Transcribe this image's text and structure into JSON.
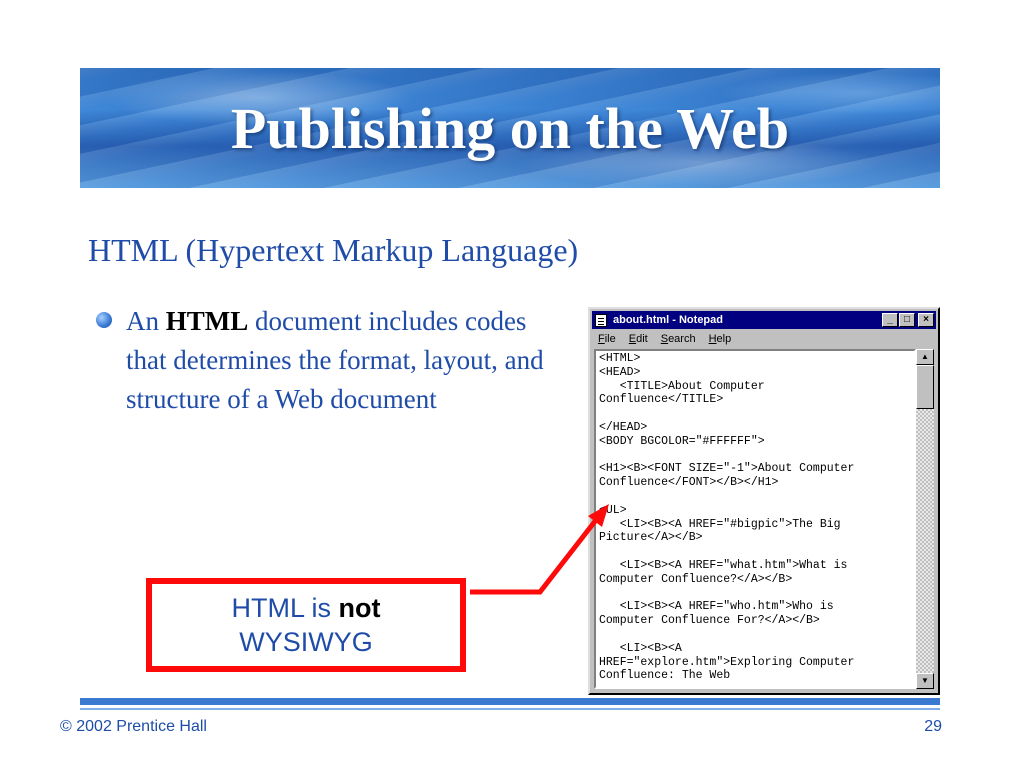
{
  "slide": {
    "title": "Publishing on the Web",
    "subtitle": "HTML (Hypertext Markup Language)",
    "bullet": {
      "prefix": "An ",
      "bold": "HTML",
      "rest": " document includes codes that determines the format, layout, and structure of a Web document"
    },
    "callout": {
      "line1_prefix": "HTML is ",
      "line1_bold": "not",
      "line2": "WYSIWYG"
    },
    "footer": {
      "copyright_symbol": "©",
      "copyright_text": " 2002 Prentice Hall",
      "page_number": "29"
    }
  },
  "notepad": {
    "window_title": "about.html - Notepad",
    "title_buttons": {
      "minimize": "_",
      "maximize": "□",
      "close": "×"
    },
    "menu": [
      "File",
      "Edit",
      "Search",
      "Help"
    ],
    "lines": [
      "<HTML>",
      "<HEAD>",
      "   <TITLE>About Computer",
      "Confluence</TITLE>",
      "",
      "</HEAD>",
      "<BODY BGCOLOR=\"#FFFFFF\">",
      "",
      "<H1><B><FONT SIZE=\"-1\">About Computer",
      "Confluence</FONT></B></H1>",
      "",
      "<UL>",
      "   <LI><B><A HREF=\"#bigpic\">The Big",
      "Picture</A></B>",
      "",
      "   <LI><B><A HREF=\"what.htm\">What is",
      "Computer Confluence?</A></B>",
      "",
      "   <LI><B><A HREF=\"who.htm\">Who is",
      "Computer Confluence For?</A></B>",
      "",
      "   <LI><B><A",
      "HREF=\"explore.htm\">Exploring Computer",
      "Confluence: The Web"
    ],
    "scroll_up": "▲",
    "scroll_down": "▼"
  },
  "colors": {
    "text_blue": "#1f4ca8",
    "callout_border": "#ff0a0a",
    "titlebar": "#000080"
  }
}
